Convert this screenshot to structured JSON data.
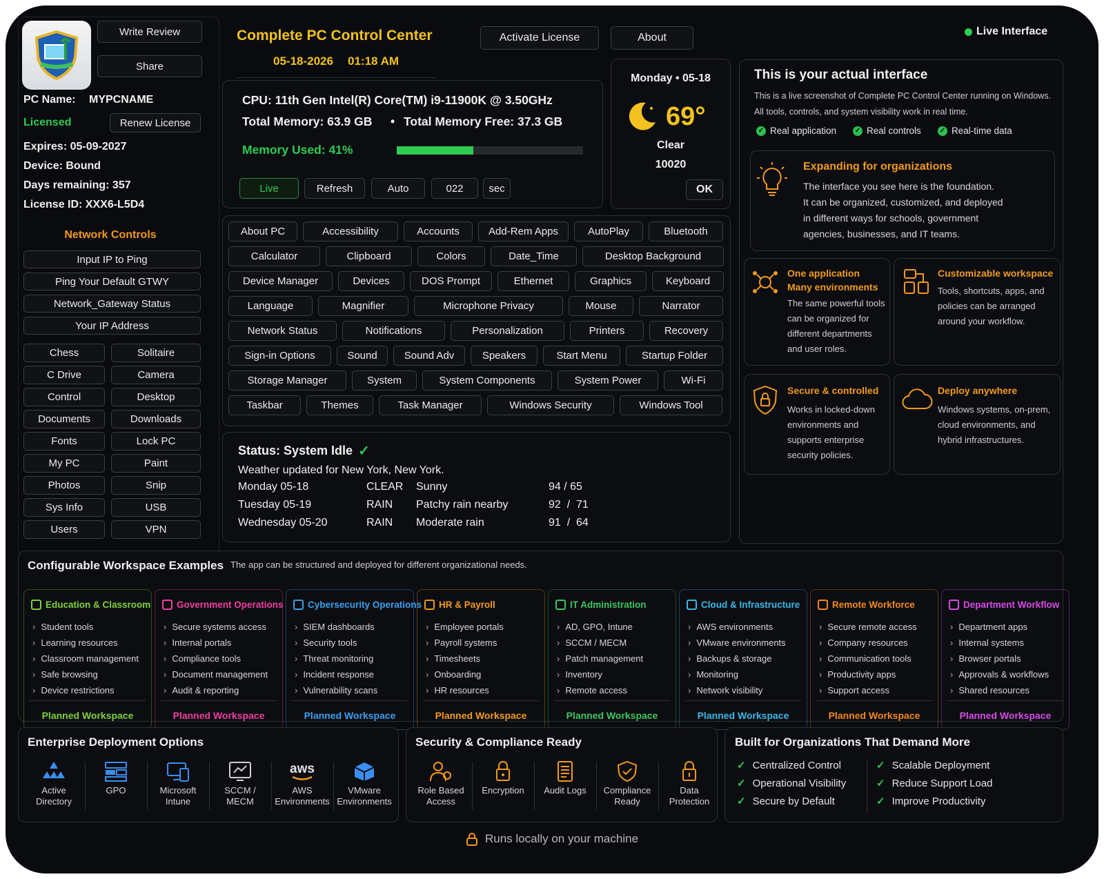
{
  "header": {
    "app_title": "Complete PC Control Center",
    "date": "05-18-2026",
    "time": "01:18 AM",
    "activate_label": "Activate License",
    "about_label": "About",
    "live_indicator": "Live Interface",
    "write_review": "Write Review",
    "share": "Share"
  },
  "license": {
    "pc_name_label": "PC Name:",
    "pc_name": "MYPCNAME",
    "status": "Licensed",
    "renew": "Renew License",
    "expires": "Expires: 05-09-2027",
    "device": "Device: Bound",
    "days": "Days remaining: 357",
    "license_id": "License ID: XXX6-L5D4"
  },
  "network": {
    "title": "Network Controls",
    "items": [
      "Input IP to Ping",
      "Ping Your Default GTWY",
      "Network_Gateway Status",
      "Your IP Address"
    ]
  },
  "shortcuts": [
    "Chess",
    "Solitaire",
    "C Drive",
    "Camera",
    "Control",
    "Desktop",
    "Documents",
    "Downloads",
    "Fonts",
    "Lock PC",
    "My PC",
    "Paint",
    "Photos",
    "Snip",
    "Sys Info",
    "USB",
    "Users",
    "VPN"
  ],
  "system": {
    "cpu": "CPU: 11th Gen Intel(R) Core(TM) i9-11900K @ 3.50GHz",
    "total_mem": "Total Memory: 63.9 GB",
    "dot": "•",
    "free_mem": "Total Memory Free: 37.3 GB",
    "mem_used": "Memory Used: 41%",
    "mem_fraction": 0.41,
    "controls": {
      "live": "Live",
      "refresh": "Refresh",
      "auto": "Auto",
      "interval": "022",
      "unit": "sec"
    }
  },
  "weather": {
    "day": "Monday • 05-18",
    "temp": "69°",
    "cond": "Clear",
    "zip": "10020",
    "ok": "OK"
  },
  "settings": [
    [
      "About PC",
      "Accessibility",
      "Accounts",
      "Add-Rem Apps",
      "AutoPlay",
      "Bluetooth"
    ],
    [
      "Calculator",
      "Clipboard",
      "Colors",
      "Date_Time",
      "Desktop Background"
    ],
    [
      "Device Manager",
      "Devices",
      "DOS Prompt",
      "Ethernet",
      "Graphics",
      "Keyboard"
    ],
    [
      "Language",
      "Magnifier",
      "Microphone Privacy",
      "Mouse",
      "Narrator"
    ],
    [
      "Network Status",
      "Notifications",
      "Personalization",
      "Printers",
      "Recovery"
    ],
    [
      "Sign-in Options",
      "Sound",
      "Sound Adv",
      "Speakers",
      "Start Menu",
      "Startup Folder"
    ],
    [
      "Storage Manager",
      "System",
      "System Components",
      "System Power",
      "Wi-Fi"
    ],
    [
      "Taskbar",
      "Themes",
      "Task Manager",
      "Windows Security",
      "Windows Tool"
    ]
  ],
  "status": {
    "title": "Status: System Idle",
    "updated": "Weather updated for New York, New York.",
    "rows": [
      [
        "Monday 05-18",
        "CLEAR",
        "Sunny",
        "94 / 65"
      ],
      [
        "Tuesday 05-19",
        "RAIN",
        "Patchy rain nearby",
        "92  /  71"
      ],
      [
        "Wednesday 05-20",
        "RAIN",
        "Moderate rain",
        "91  /  64"
      ]
    ]
  },
  "promo": {
    "title": "This is your actual interface",
    "desc1": "This is a live screenshot of Complete PC Control Center running on Windows.",
    "desc2": "All tools, controls, and system visibility work in real time.",
    "checks": [
      "Real application",
      "Real controls",
      "Real-time data"
    ],
    "expand_title": "Expanding for organizations",
    "expand_lines": [
      "The interface you see here is the foundation.",
      "It can be organized, customized, and deployed",
      "in different ways for schools, government",
      "agencies, businesses, and IT teams."
    ],
    "cards": [
      {
        "title1": "One application",
        "title2": "Many environments",
        "lines": [
          "The same powerful tools",
          "can be organized for",
          "different departments",
          "and user roles."
        ]
      },
      {
        "title1": "Customizable workspace",
        "title2": "",
        "lines": [
          "Tools, shortcuts, apps, and",
          "policies can be arranged",
          "around your workflow."
        ]
      },
      {
        "title1": "Secure & controlled",
        "title2": "",
        "lines": [
          "Works in locked-down",
          "environments and",
          "supports enterprise",
          "security policies."
        ]
      },
      {
        "title1": "Deploy anywhere",
        "title2": "",
        "lines": [
          "Windows systems, on-prem,",
          "cloud environments, and",
          "hybrid infrastructures."
        ]
      }
    ]
  },
  "workspaces": {
    "title": "Configurable Workspace Examples",
    "subtitle": "The app can be structured and deployed for different organizational needs.",
    "footer": "Planned Workspace",
    "items": [
      {
        "name": "Education & Classroom",
        "color": "#7fd23a",
        "items": [
          "Student tools",
          "Learning resources",
          "Classroom management",
          "Safe browsing",
          "Device restrictions"
        ]
      },
      {
        "name": "Government Operations",
        "color": "#f03fa6",
        "items": [
          "Secure systems access",
          "Internal portals",
          "Compliance tools",
          "Document management",
          "Audit & reporting"
        ]
      },
      {
        "name": "Cybersecurity Operations",
        "color": "#3aa0f0",
        "items": [
          "SIEM dashboards",
          "Security tools",
          "Threat monitoring",
          "Incident response",
          "Vulnerability scans"
        ]
      },
      {
        "name": "HR & Payroll",
        "color": "#f39a1e",
        "items": [
          "Employee portals",
          "Payroll systems",
          "Timesheets",
          "Onboarding",
          "HR resources"
        ]
      },
      {
        "name": "IT Administration",
        "color": "#3cc860",
        "items": [
          "AD, GPO, Intune",
          "SCCM / MECM",
          "Patch management",
          "Inventory",
          "Remote access"
        ]
      },
      {
        "name": "Cloud & Infrastructure",
        "color": "#3ab8e8",
        "items": [
          "AWS environments",
          "VMware environments",
          "Backups & storage",
          "Monitoring",
          "Network visibility"
        ]
      },
      {
        "name": "Remote Workforce",
        "color": "#f3891e",
        "items": [
          "Secure remote access",
          "Company resources",
          "Communication tools",
          "Productivity apps",
          "Support access"
        ]
      },
      {
        "name": "Department Workflow",
        "color": "#d84be8",
        "items": [
          "Department apps",
          "Internal systems",
          "Browser portals",
          "Approvals & workflows",
          "Shared resources"
        ]
      }
    ]
  },
  "deploy": {
    "title": "Enterprise Deployment Options",
    "items": [
      [
        "Active",
        "Directory"
      ],
      [
        "GPO",
        ""
      ],
      [
        "Microsoft",
        "Intune"
      ],
      [
        "SCCM /",
        "MECM"
      ],
      [
        "AWS",
        "Environments"
      ],
      [
        "VMware",
        "Environments"
      ]
    ]
  },
  "security": {
    "title": "Security & Compliance Ready",
    "items": [
      [
        "Role Based",
        "Access"
      ],
      [
        "Encryption",
        ""
      ],
      [
        "Audit Logs",
        ""
      ],
      [
        "Compliance",
        "Ready"
      ],
      [
        "Data",
        "Protection"
      ]
    ]
  },
  "built": {
    "title": "Built for Organizations That Demand More",
    "items": [
      "Centralized Control",
      "Scalable Deployment",
      "Operational Visibility",
      "Reduce Support Load",
      "Secure by Default",
      "Improve Productivity"
    ]
  },
  "footer": {
    "text": "Runs locally on your machine"
  },
  "colors": {
    "accent_orange": "#f39a1e",
    "accent_yellow": "#f3c21f",
    "green": "#2ecc50",
    "bg": "#0a0b0e"
  }
}
